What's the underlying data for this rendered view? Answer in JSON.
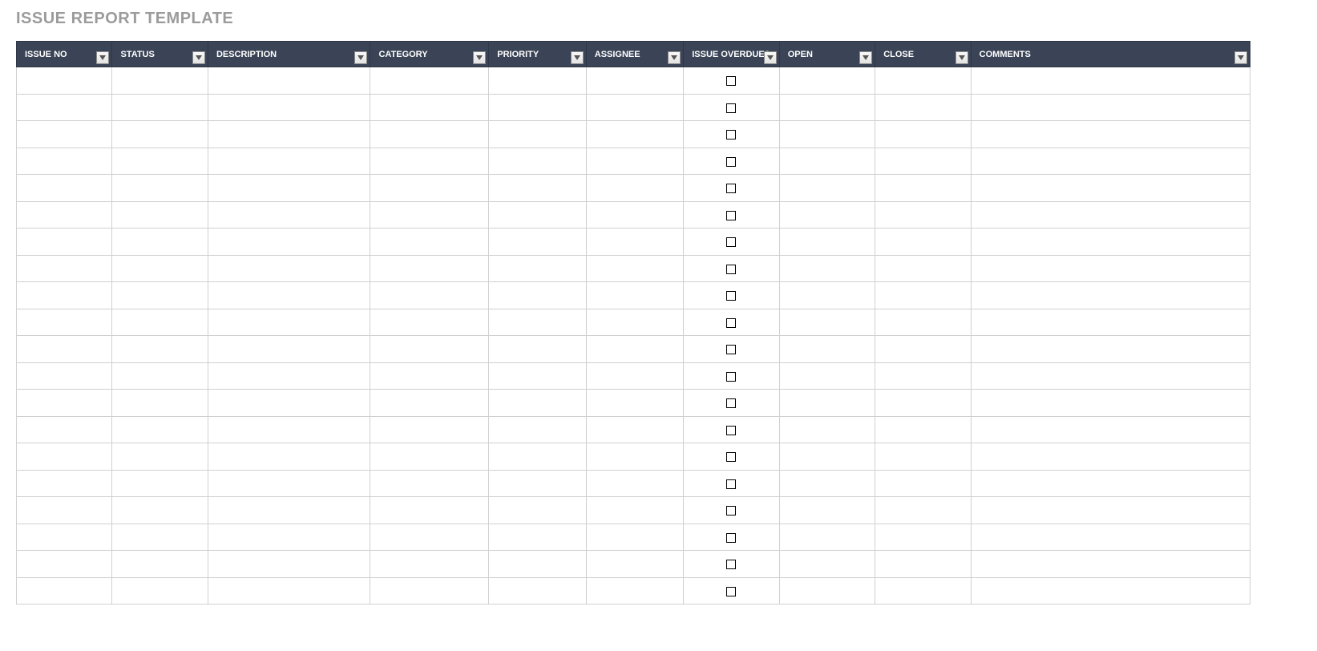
{
  "title": "ISSUE REPORT TEMPLATE",
  "columns": [
    {
      "key": "issue_no",
      "label": "ISSUE NO",
      "filter": true
    },
    {
      "key": "status",
      "label": "STATUS",
      "filter": true
    },
    {
      "key": "description",
      "label": "DESCRIPTION",
      "filter": true
    },
    {
      "key": "category",
      "label": "CATEGORY",
      "filter": true
    },
    {
      "key": "priority",
      "label": "PRIORITY",
      "filter": true
    },
    {
      "key": "assignee",
      "label": "ASSIGNEE",
      "filter": true
    },
    {
      "key": "issue_overdue",
      "label": "ISSUE OVERDUE?",
      "filter": true,
      "checkbox": true
    },
    {
      "key": "open",
      "label": "OPEN",
      "filter": true
    },
    {
      "key": "close",
      "label": "CLOSE",
      "filter": true
    },
    {
      "key": "comments",
      "label": "COMMENTS",
      "filter": true
    }
  ],
  "rows": [
    {
      "issue_no": "",
      "status": "",
      "description": "",
      "category": "",
      "priority": "",
      "assignee": "",
      "issue_overdue": false,
      "open": "",
      "close": "",
      "comments": ""
    },
    {
      "issue_no": "",
      "status": "",
      "description": "",
      "category": "",
      "priority": "",
      "assignee": "",
      "issue_overdue": false,
      "open": "",
      "close": "",
      "comments": ""
    },
    {
      "issue_no": "",
      "status": "",
      "description": "",
      "category": "",
      "priority": "",
      "assignee": "",
      "issue_overdue": false,
      "open": "",
      "close": "",
      "comments": ""
    },
    {
      "issue_no": "",
      "status": "",
      "description": "",
      "category": "",
      "priority": "",
      "assignee": "",
      "issue_overdue": false,
      "open": "",
      "close": "",
      "comments": ""
    },
    {
      "issue_no": "",
      "status": "",
      "description": "",
      "category": "",
      "priority": "",
      "assignee": "",
      "issue_overdue": false,
      "open": "",
      "close": "",
      "comments": ""
    },
    {
      "issue_no": "",
      "status": "",
      "description": "",
      "category": "",
      "priority": "",
      "assignee": "",
      "issue_overdue": false,
      "open": "",
      "close": "",
      "comments": ""
    },
    {
      "issue_no": "",
      "status": "",
      "description": "",
      "category": "",
      "priority": "",
      "assignee": "",
      "issue_overdue": false,
      "open": "",
      "close": "",
      "comments": ""
    },
    {
      "issue_no": "",
      "status": "",
      "description": "",
      "category": "",
      "priority": "",
      "assignee": "",
      "issue_overdue": false,
      "open": "",
      "close": "",
      "comments": ""
    },
    {
      "issue_no": "",
      "status": "",
      "description": "",
      "category": "",
      "priority": "",
      "assignee": "",
      "issue_overdue": false,
      "open": "",
      "close": "",
      "comments": ""
    },
    {
      "issue_no": "",
      "status": "",
      "description": "",
      "category": "",
      "priority": "",
      "assignee": "",
      "issue_overdue": false,
      "open": "",
      "close": "",
      "comments": ""
    },
    {
      "issue_no": "",
      "status": "",
      "description": "",
      "category": "",
      "priority": "",
      "assignee": "",
      "issue_overdue": false,
      "open": "",
      "close": "",
      "comments": ""
    },
    {
      "issue_no": "",
      "status": "",
      "description": "",
      "category": "",
      "priority": "",
      "assignee": "",
      "issue_overdue": false,
      "open": "",
      "close": "",
      "comments": ""
    },
    {
      "issue_no": "",
      "status": "",
      "description": "",
      "category": "",
      "priority": "",
      "assignee": "",
      "issue_overdue": false,
      "open": "",
      "close": "",
      "comments": ""
    },
    {
      "issue_no": "",
      "status": "",
      "description": "",
      "category": "",
      "priority": "",
      "assignee": "",
      "issue_overdue": false,
      "open": "",
      "close": "",
      "comments": ""
    },
    {
      "issue_no": "",
      "status": "",
      "description": "",
      "category": "",
      "priority": "",
      "assignee": "",
      "issue_overdue": false,
      "open": "",
      "close": "",
      "comments": ""
    },
    {
      "issue_no": "",
      "status": "",
      "description": "",
      "category": "",
      "priority": "",
      "assignee": "",
      "issue_overdue": false,
      "open": "",
      "close": "",
      "comments": ""
    },
    {
      "issue_no": "",
      "status": "",
      "description": "",
      "category": "",
      "priority": "",
      "assignee": "",
      "issue_overdue": false,
      "open": "",
      "close": "",
      "comments": ""
    },
    {
      "issue_no": "",
      "status": "",
      "description": "",
      "category": "",
      "priority": "",
      "assignee": "",
      "issue_overdue": false,
      "open": "",
      "close": "",
      "comments": ""
    },
    {
      "issue_no": "",
      "status": "",
      "description": "",
      "category": "",
      "priority": "",
      "assignee": "",
      "issue_overdue": false,
      "open": "",
      "close": "",
      "comments": ""
    },
    {
      "issue_no": "",
      "status": "",
      "description": "",
      "category": "",
      "priority": "",
      "assignee": "",
      "issue_overdue": false,
      "open": "",
      "close": "",
      "comments": ""
    }
  ]
}
